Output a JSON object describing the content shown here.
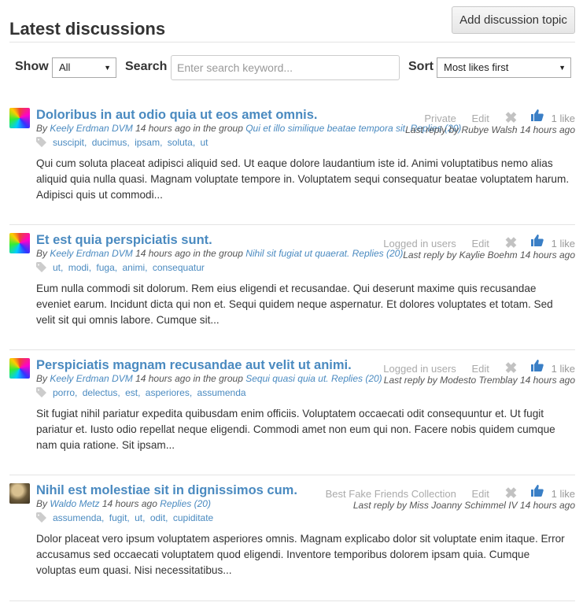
{
  "page": {
    "title": "Latest discussions",
    "add_button": "Add discussion topic"
  },
  "filters": {
    "show_label": "Show",
    "show_value": "All",
    "search_label": "Search",
    "search_placeholder": "Enter search keyword...",
    "sort_label": "Sort",
    "sort_value": "Most likes first"
  },
  "topics": [
    {
      "title": "Doloribus in aut odio quia ut eos amet omnis.",
      "visibility": "Private",
      "edit": "Edit",
      "likes": "1 like",
      "by_prefix": "By",
      "author": "Keely Erdman DVM",
      "time": "14 hours ago",
      "group_prefix": "in the group",
      "group": "Qui et illo similique beatae tempora sit.",
      "replies": "Replies (20)",
      "last_reply": "Last reply by Rubye Walsh 14 hours ago",
      "tags": [
        "suscipit",
        "ducimus",
        "ipsam",
        "soluta",
        "ut"
      ],
      "excerpt": "Qui cum soluta placeat adipisci aliquid sed. Ut eaque dolore laudantium iste id. Animi voluptatibus nemo alias aliquid quia nulla quasi. Magnam voluptate tempore in. Voluptatem sequi consequatur beatae voluptatem harum. Adipisci quis ut commodi..."
    },
    {
      "title": "Et est quia perspiciatis sunt.",
      "visibility": "Logged in users",
      "edit": "Edit",
      "likes": "1 like",
      "by_prefix": "By",
      "author": "Keely Erdman DVM",
      "time": "14 hours ago",
      "group_prefix": "in the group",
      "group": "Nihil sit fugiat ut quaerat.",
      "replies": "Replies (20)",
      "last_reply": "Last reply by Kaylie Boehm 14 hours ago",
      "tags": [
        "ut",
        "modi",
        "fuga",
        "animi",
        "consequatur"
      ],
      "excerpt": "Eum nulla commodi sit dolorum. Rem eius eligendi et recusandae. Qui deserunt maxime quis recusandae eveniet earum. Incidunt dicta qui non et. Sequi quidem neque aspernatur. Et dolores voluptates et totam. Sed velit sit qui omnis labore. Cumque sit..."
    },
    {
      "title": "Perspiciatis magnam recusandae aut velit ut animi.",
      "visibility": "Logged in users",
      "edit": "Edit",
      "likes": "1 like",
      "by_prefix": "By",
      "author": "Keely Erdman DVM",
      "time": "14 hours ago",
      "group_prefix": "in the group",
      "group": "Sequi quasi quia ut.",
      "replies": "Replies (20)",
      "last_reply": "Last reply by Modesto Tremblay 14 hours ago",
      "tags": [
        "porro",
        "delectus",
        "est",
        "asperiores",
        "assumenda"
      ],
      "excerpt": "Sit fugiat nihil pariatur expedita quibusdam enim officiis. Voluptatem occaecati odit consequuntur et. Ut fugit pariatur et. Iusto odio repellat neque eligendi. Commodi amet non eum qui non. Facere nobis quidem cumque nam quia ratione. Sit ipsam..."
    },
    {
      "title": "Nihil est molestiae sit in dignissimos cum.",
      "visibility": "Best Fake Friends Collection",
      "edit": "Edit",
      "likes": "1 like",
      "by_prefix": "By",
      "author": "Waldo Metz",
      "time": "14 hours ago",
      "group_prefix": "",
      "group": "",
      "replies": "Replies (20)",
      "last_reply": "Last reply by Miss Joanny Schimmel IV 14 hours ago",
      "tags": [
        "assumenda",
        "fugit",
        "ut",
        "odit",
        "cupiditate"
      ],
      "excerpt": "Dolor placeat vero ipsum voluptatem asperiores omnis. Magnam explicabo dolor sit voluptate enim itaque. Error accusamus sed occaecati voluptatem quod eligendi. Inventore temporibus dolorem ipsam quia. Cumque voluptas eum quasi. Nisi necessitatibus..."
    }
  ],
  "colors": {
    "link": "#4a8ac0",
    "like": "#3a7fc6",
    "muted": "#aaaaaa"
  }
}
